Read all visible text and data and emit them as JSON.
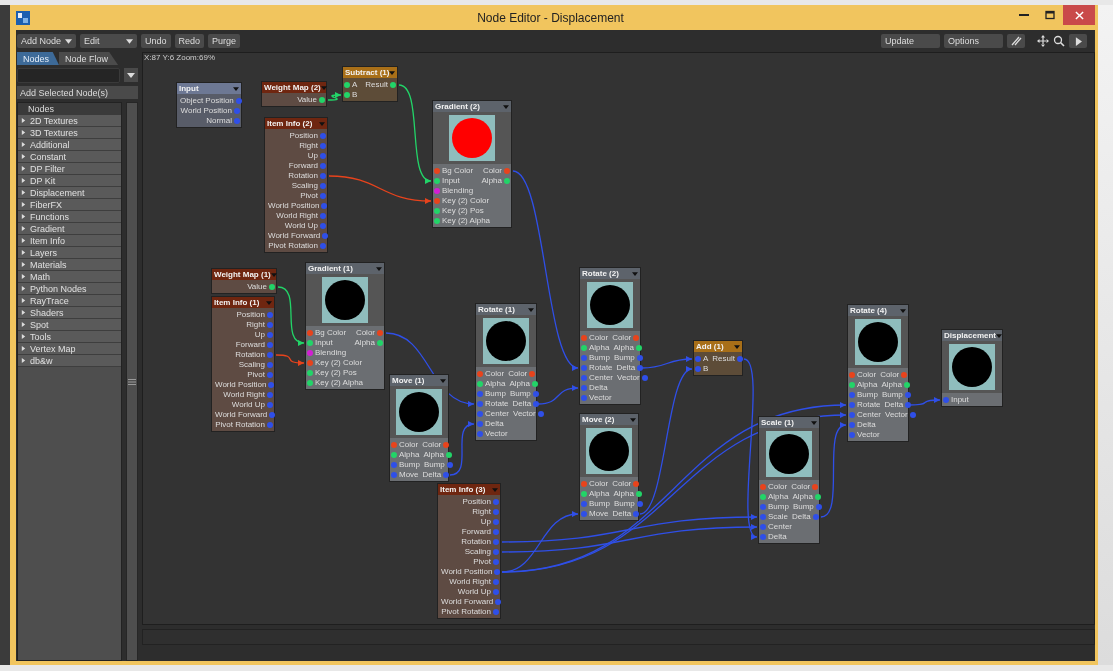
{
  "window": {
    "title": "Node Editor - Displacement"
  },
  "toolbar": {
    "menus": [
      "Add Node",
      "Edit"
    ],
    "buttons": [
      "Undo",
      "Redo",
      "Purge"
    ],
    "right_buttons": [
      "Update",
      "Options"
    ]
  },
  "tabs": [
    {
      "label": "Nodes",
      "selected": true
    },
    {
      "label": "Node Flow",
      "selected": false
    }
  ],
  "add_button": "Add Selected Node(s)",
  "node_list": {
    "header": "Nodes",
    "items": [
      {
        "label": "2D Textures",
        "expanded": false
      },
      {
        "label": "3D Textures",
        "expanded": false
      },
      {
        "label": "Additional",
        "expanded": false
      },
      {
        "label": "Constant",
        "expanded": false
      },
      {
        "label": "DP Filter",
        "expanded": false
      },
      {
        "label": "DP Kit",
        "expanded": false
      },
      {
        "label": "Displacement",
        "expanded": false
      },
      {
        "label": "FiberFX",
        "expanded": false
      },
      {
        "label": "Functions",
        "expanded": false
      },
      {
        "label": "Gradient",
        "expanded": false
      },
      {
        "label": "Item Info",
        "expanded": false
      },
      {
        "label": "Layers",
        "expanded": false
      },
      {
        "label": "Materials",
        "expanded": false
      },
      {
        "label": "Math",
        "expanded": false
      },
      {
        "label": "Python Nodes",
        "expanded": false
      },
      {
        "label": "RayTrace",
        "expanded": false
      },
      {
        "label": "Shaders",
        "expanded": false
      },
      {
        "label": "Spot",
        "expanded": false
      },
      {
        "label": "Tools",
        "expanded": false
      },
      {
        "label": "Vertex Map",
        "expanded": false
      },
      {
        "label": "db&w",
        "expanded": false
      }
    ]
  },
  "canvas": {
    "status": "X:87 Y:6 Zoom:69%",
    "nodes": [
      {
        "title": "Input",
        "kind": "input",
        "rows": [
          {
            "output": "Object Position",
            "color": "#2f4fe8"
          },
          {
            "output": "World Position",
            "color": "#2f4fe8"
          },
          {
            "output": "Normal",
            "color": "#2f4fe8"
          }
        ]
      },
      {
        "title": "Weight Map (2)",
        "kind": "item",
        "rows": [
          {
            "output": "Value",
            "color": "#22d468"
          }
        ]
      },
      {
        "title": "Subtract (1)",
        "kind": "math",
        "rows": [
          {
            "input": "A",
            "output": "Result",
            "color": "#22d468"
          },
          {
            "input": "B",
            "color": "#22d468"
          }
        ]
      },
      {
        "title": "Item Info (2)",
        "kind": "item",
        "rows": [
          {
            "output": "Position",
            "color": "#2f4fe8"
          },
          {
            "output": "Right",
            "color": "#2f4fe8"
          },
          {
            "output": "Up",
            "color": "#2f4fe8"
          },
          {
            "output": "Forward",
            "color": "#2f4fe8"
          },
          {
            "output": "Rotation",
            "color": "#2f4fe8"
          },
          {
            "output": "Scaling",
            "color": "#2f4fe8"
          },
          {
            "output": "Pivot",
            "color": "#2f4fe8"
          },
          {
            "output": "World Position",
            "color": "#2f4fe8"
          },
          {
            "output": "World Right",
            "color": "#2f4fe8"
          },
          {
            "output": "World Up",
            "color": "#2f4fe8"
          },
          {
            "output": "World Forward",
            "color": "#2f4fe8"
          },
          {
            "output": "Pivot Rotation",
            "color": "#2f4fe8"
          }
        ]
      },
      {
        "title": "Gradient (2)",
        "kind": "texture",
        "preview": {
          "color": "#ff0000"
        },
        "rows": [
          {
            "input": "Bg Color",
            "output": "Color",
            "color": "#e8431c"
          },
          {
            "input": "Input",
            "output": "Alpha",
            "color": "#22d468"
          },
          {
            "input": "Blending",
            "color": "#d41ed4"
          },
          {
            "input": "Key (2) Color",
            "color": "#e8431c"
          },
          {
            "input": "Key (2) Pos",
            "color": "#22d468"
          },
          {
            "input": "Key (2) Alpha",
            "color": "#22d468"
          }
        ]
      },
      {
        "title": "Weight Map (1)",
        "kind": "item",
        "rows": [
          {
            "output": "Value",
            "color": "#22d468"
          }
        ]
      },
      {
        "title": "Item Info (1)",
        "kind": "item",
        "rows": [
          {
            "output": "Position",
            "color": "#2f4fe8"
          },
          {
            "output": "Right",
            "color": "#2f4fe8"
          },
          {
            "output": "Up",
            "color": "#2f4fe8"
          },
          {
            "output": "Forward",
            "color": "#2f4fe8"
          },
          {
            "output": "Rotation",
            "color": "#2f4fe8"
          },
          {
            "output": "Scaling",
            "color": "#2f4fe8"
          },
          {
            "output": "Pivot",
            "color": "#2f4fe8"
          },
          {
            "output": "World Position",
            "color": "#2f4fe8"
          },
          {
            "output": "World Right",
            "color": "#2f4fe8"
          },
          {
            "output": "World Up",
            "color": "#2f4fe8"
          },
          {
            "output": "World Forward",
            "color": "#2f4fe8"
          },
          {
            "output": "Pivot Rotation",
            "color": "#2f4fe8"
          }
        ]
      },
      {
        "title": "Gradient (1)",
        "kind": "texture",
        "preview": {
          "color": "#000000"
        },
        "rows": [
          {
            "input": "Bg Color",
            "output": "Color",
            "color": "#e8431c"
          },
          {
            "input": "Input",
            "output": "Alpha",
            "color": "#22d468"
          },
          {
            "input": "Blending",
            "color": "#d41ed4"
          },
          {
            "input": "Key (2) Color",
            "color": "#e8431c"
          },
          {
            "input": "Key (2) Pos",
            "color": "#22d468"
          },
          {
            "input": "Key (2) Alpha",
            "color": "#22d468"
          }
        ]
      },
      {
        "title": "Rotate (1)",
        "kind": "texture",
        "preview": {
          "color": "#000000"
        },
        "rows": [
          {
            "input": "Color",
            "output": "Color",
            "color": "#e8431c"
          },
          {
            "input": "Alpha",
            "output": "Alpha",
            "color": "#22d468"
          },
          {
            "input": "Bump",
            "output": "Bump",
            "color": "#2f4fe8"
          },
          {
            "input": "Rotate",
            "output": "Delta",
            "color": "#2f4fe8"
          },
          {
            "input": "Center",
            "output": "Vector",
            "color": "#2f4fe8"
          },
          {
            "input": "Delta",
            "color": "#2f4fe8"
          },
          {
            "input": "Vector",
            "color": "#2f4fe8"
          }
        ]
      },
      {
        "title": "Move (1)",
        "kind": "texture",
        "preview": {
          "color": "#000000"
        },
        "rows": [
          {
            "input": "Color",
            "output": "Color",
            "color": "#e8431c"
          },
          {
            "input": "Alpha",
            "output": "Alpha",
            "color": "#22d468"
          },
          {
            "input": "Bump",
            "output": "Bump",
            "color": "#2f4fe8"
          },
          {
            "input": "Move",
            "output": "Delta",
            "color": "#2f4fe8"
          }
        ]
      },
      {
        "title": "Rotate (2)",
        "kind": "texture",
        "preview": {
          "color": "#000000"
        },
        "rows": [
          {
            "input": "Color",
            "output": "Color",
            "color": "#e8431c"
          },
          {
            "input": "Alpha",
            "output": "Alpha",
            "color": "#22d468"
          },
          {
            "input": "Bump",
            "output": "Bump",
            "color": "#2f4fe8"
          },
          {
            "input": "Rotate",
            "output": "Delta",
            "color": "#2f4fe8"
          },
          {
            "input": "Center",
            "output": "Vector",
            "color": "#2f4fe8"
          },
          {
            "input": "Delta",
            "color": "#2f4fe8"
          },
          {
            "input": "Vector",
            "color": "#2f4fe8"
          }
        ]
      },
      {
        "title": "Add (1)",
        "kind": "math",
        "rows": [
          {
            "input": "A",
            "output": "Result",
            "color": "#2f4fe8"
          },
          {
            "input": "B",
            "color": "#2f4fe8"
          }
        ]
      },
      {
        "title": "Move (2)",
        "kind": "texture",
        "preview": {
          "color": "#000000"
        },
        "rows": [
          {
            "input": "Color",
            "output": "Color",
            "color": "#e8431c"
          },
          {
            "input": "Alpha",
            "output": "Alpha",
            "color": "#22d468"
          },
          {
            "input": "Bump",
            "output": "Bump",
            "color": "#2f4fe8"
          },
          {
            "input": "Move",
            "output": "Delta",
            "color": "#2f4fe8"
          }
        ]
      },
      {
        "title": "Item Info (3)",
        "kind": "item",
        "rows": [
          {
            "output": "Position",
            "color": "#2f4fe8"
          },
          {
            "output": "Right",
            "color": "#2f4fe8"
          },
          {
            "output": "Up",
            "color": "#2f4fe8"
          },
          {
            "output": "Forward",
            "color": "#2f4fe8"
          },
          {
            "output": "Rotation",
            "color": "#2f4fe8"
          },
          {
            "output": "Scaling",
            "color": "#2f4fe8"
          },
          {
            "output": "Pivot",
            "color": "#2f4fe8"
          },
          {
            "output": "World Position",
            "color": "#2f4fe8"
          },
          {
            "output": "World Right",
            "color": "#2f4fe8"
          },
          {
            "output": "World Up",
            "color": "#2f4fe8"
          },
          {
            "output": "World Forward",
            "color": "#2f4fe8"
          },
          {
            "output": "Pivot Rotation",
            "color": "#2f4fe8"
          }
        ]
      },
      {
        "title": "Scale (1)",
        "kind": "texture",
        "preview": {
          "color": "#000000"
        },
        "rows": [
          {
            "input": "Color",
            "output": "Color",
            "color": "#e8431c"
          },
          {
            "input": "Alpha",
            "output": "Alpha",
            "color": "#22d468"
          },
          {
            "input": "Bump",
            "output": "Bump",
            "color": "#2f4fe8"
          },
          {
            "input": "Scale",
            "output": "Delta",
            "color": "#2f4fe8"
          },
          {
            "input": "Center",
            "color": "#2f4fe8"
          },
          {
            "input": "Delta",
            "color": "#2f4fe8"
          }
        ]
      },
      {
        "title": "Rotate (4)",
        "kind": "texture",
        "preview": {
          "color": "#000000"
        },
        "rows": [
          {
            "input": "Color",
            "output": "Color",
            "color": "#e8431c"
          },
          {
            "input": "Alpha",
            "output": "Alpha",
            "color": "#22d468"
          },
          {
            "input": "Bump",
            "output": "Bump",
            "color": "#2f4fe8"
          },
          {
            "input": "Rotate",
            "output": "Delta",
            "color": "#2f4fe8"
          },
          {
            "input": "Center",
            "output": "Vector",
            "color": "#2f4fe8"
          },
          {
            "input": "Delta",
            "color": "#2f4fe8"
          },
          {
            "input": "Vector",
            "color": "#2f4fe8"
          }
        ]
      },
      {
        "title": "Displacement",
        "kind": "texture",
        "preview": {
          "color": "#000000"
        },
        "rows": [
          {
            "input": "Input",
            "color": "#2f4fe8"
          }
        ]
      }
    ]
  }
}
